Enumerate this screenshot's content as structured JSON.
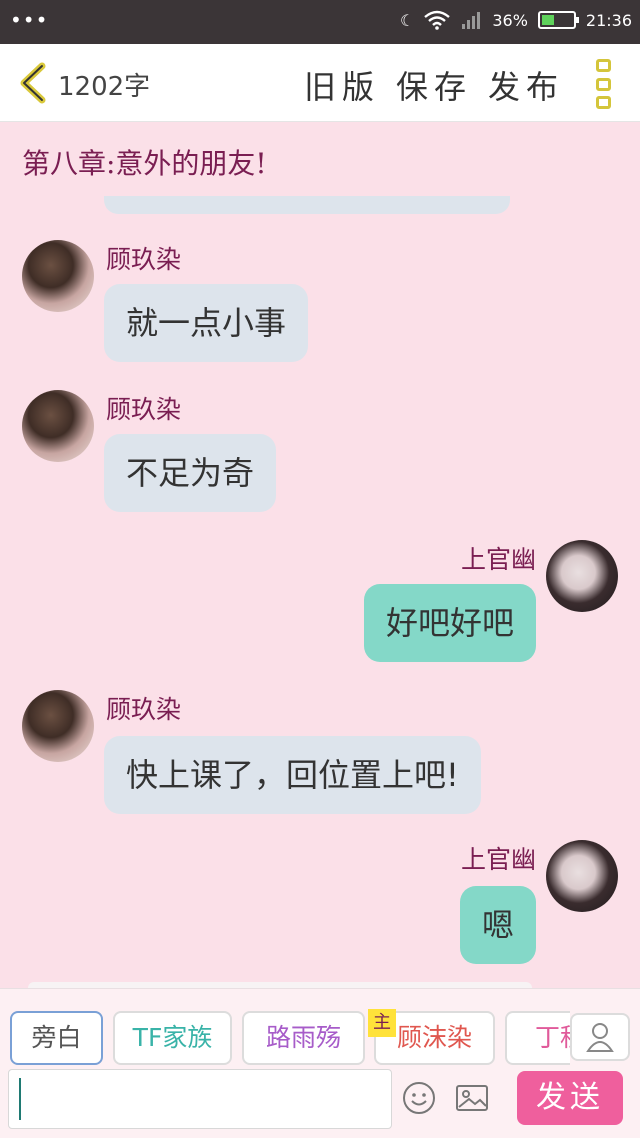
{
  "status": {
    "battery": "36%",
    "time": "21:36"
  },
  "header": {
    "word_count": "1202字",
    "old_version": "旧版",
    "save": "保存",
    "publish": "发布"
  },
  "chapter_title": "第八章:意外的朋友!",
  "messages": [
    {
      "side": "left",
      "name": "顾玖染",
      "text": "就一点小事"
    },
    {
      "side": "left",
      "name": "顾玖染",
      "text": "不足为奇"
    },
    {
      "side": "right",
      "name": "上官幽",
      "text": "好吧好吧"
    },
    {
      "side": "left",
      "name": "顾玖染",
      "text": "快上课了，回位置上吧!"
    },
    {
      "side": "right",
      "name": "上官幽",
      "text": "嗯"
    }
  ],
  "roles": [
    {
      "label": "旁白",
      "color": "#555555"
    },
    {
      "label": "TF家族",
      "color": "#39b3a8"
    },
    {
      "label": "路雨殇",
      "color": "#a75cc9"
    },
    {
      "label": "顾沫染",
      "color": "#e0574f"
    },
    {
      "label": "丁程",
      "color": "#e05a9a"
    }
  ],
  "main_badge": "主",
  "input": {
    "value": ""
  },
  "send_label": "发送",
  "colors": {
    "accent": "#ef5f9d",
    "name": "#7a1e52",
    "left_bubble": "#dde4ec",
    "right_bubble": "#84d8c8"
  }
}
